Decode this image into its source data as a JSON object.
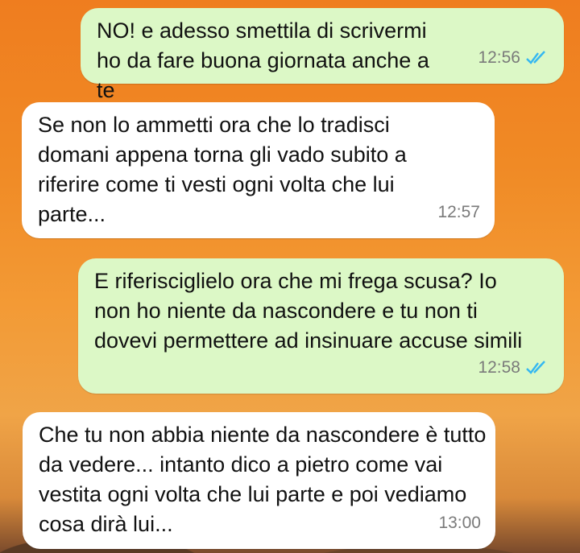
{
  "messages": [
    {
      "direction": "outgoing",
      "text": "NO! e adesso smettila di scrivermi ho da fare buona giornata anche a te",
      "time": "12:56",
      "read_ticks": true
    },
    {
      "direction": "incoming",
      "text": "Se non lo ammetti ora che lo tradisci domani appena torna gli vado subito a riferire come ti vesti ogni volta che lui parte...",
      "time": "12:57"
    },
    {
      "direction": "outgoing",
      "text": "E riferisciglielo ora che mi frega scusa? Io non ho niente da nascondere e tu non ti dovevi permettere ad insinuare accuse simili",
      "time": "12:58",
      "read_ticks": true
    },
    {
      "direction": "incoming",
      "text": "Che tu non abbia niente da nascondere è tutto da vedere... intanto dico a pietro come vai vestita ogni volta che lui parte e poi vediamo cosa dirà lui...",
      "time": "13:00"
    }
  ],
  "colors": {
    "outgoing_bubble": "#dcf8c6",
    "incoming_bubble": "#ffffff",
    "read_ticks": "#34b7f1"
  }
}
